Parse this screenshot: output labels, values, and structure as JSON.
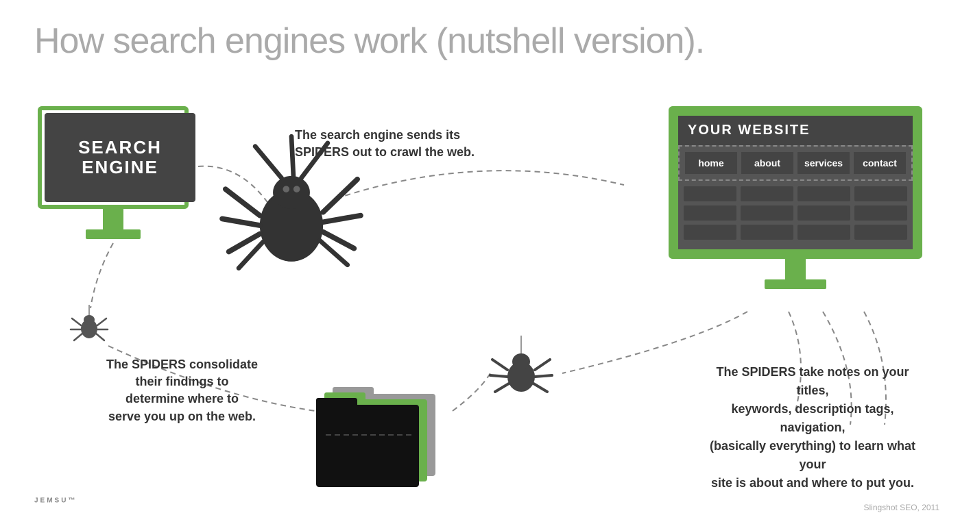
{
  "title": "How search engines work (nutshell version).",
  "search_engine": {
    "label_line1": "SEARCH",
    "label_line2": "ENGINE"
  },
  "website": {
    "title": "YOUR WEBSITE",
    "nav": [
      "home",
      "about",
      "services",
      "contact"
    ]
  },
  "annotations": {
    "top": "The search engine sends its\nSPIDERS out to crawl the web.",
    "bottom_left": "The SPIDERS consolidate\ntheir findings to\ndetermine where to\nserve you up on the web.",
    "bottom_right": "The SPIDERS take notes on your titles,\nkeywords, description tags, navigation,\n(basically everything) to learn what your\nsite is about and where to put you."
  },
  "logo": "JEMSU",
  "logo_suffix": "™",
  "credit": "Slingshot SEO, 2011",
  "colors": {
    "green": "#6ab04c",
    "dark_gray": "#444444",
    "medium_gray": "#555555",
    "text_dark": "#333333",
    "text_light": "#aaaaaa"
  }
}
